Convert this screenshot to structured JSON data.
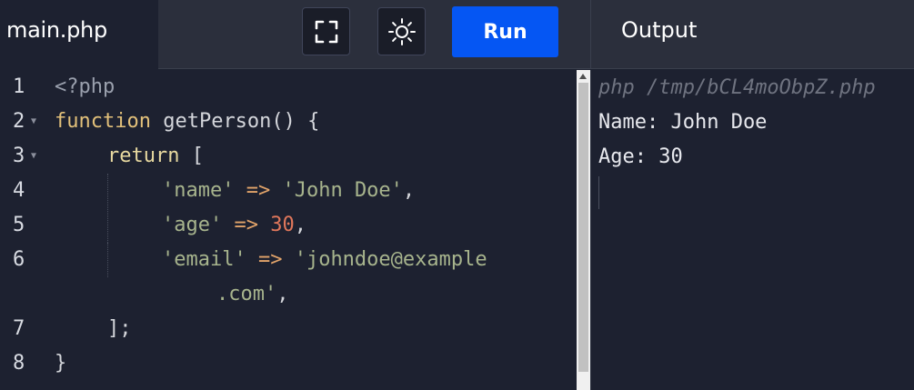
{
  "file_tab": {
    "filename": "main.php"
  },
  "toolbar": {
    "fullscreen_icon": "fullscreen-icon",
    "theme_icon": "sun-icon",
    "run_label": "Run"
  },
  "output_panel": {
    "title": "Output",
    "command": "php /tmp/bCL4moObpZ.php",
    "lines": [
      "Name: John Doe",
      "Age: 30"
    ]
  },
  "editor": {
    "line_numbers": [
      "1",
      "2",
      "3",
      "4",
      "5",
      "6",
      "7",
      "8"
    ],
    "foldable_lines": [
      "2",
      "3"
    ],
    "code": {
      "l1_open_tag": "<?php",
      "l2_keyword": "function",
      "l2_rest": " getPerson() {",
      "l3_keyword": "return",
      "l3_rest": " [",
      "l4_key": "'name'",
      "l4_arrow": " => ",
      "l4_value": "'John Doe'",
      "l4_comma": ",",
      "l5_key": "'age'",
      "l5_arrow": " => ",
      "l5_value": "30",
      "l5_comma": ",",
      "l6_key": "'email'",
      "l6_arrow": " => ",
      "l6_value_a": "'johndoe@example",
      "l6_value_b": ".com'",
      "l6_comma": ",",
      "l7_text": "];",
      "l8_text": "}"
    }
  },
  "colors": {
    "background": "#1d2130",
    "toolbar": "#2b2f3c",
    "run_button": "#0556f3",
    "keyword": "#e2c07a",
    "string": "#a7b48d",
    "number": "#e0775b"
  }
}
